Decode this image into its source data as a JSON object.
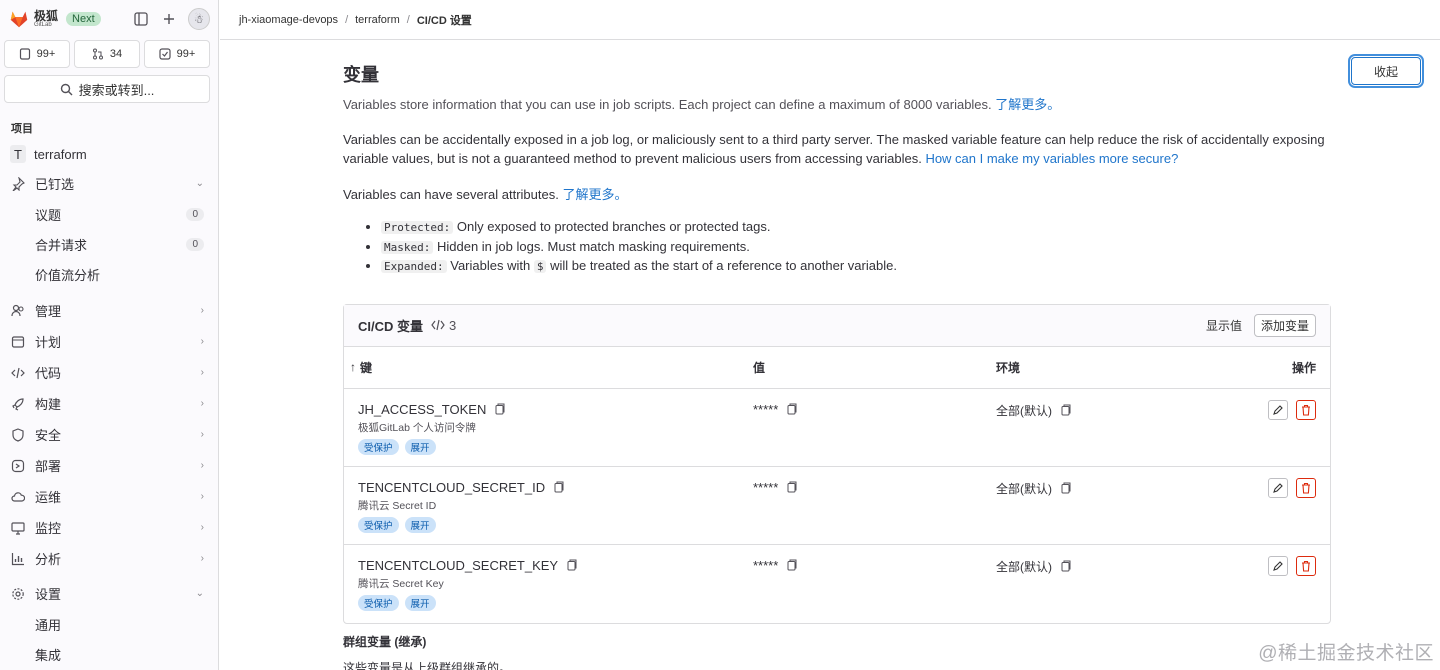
{
  "sidebar": {
    "logo_cn": "极狐",
    "logo_en": "GitLab",
    "next_badge": "Next",
    "counters": [
      {
        "icon": "issues-icon",
        "value": "99+"
      },
      {
        "icon": "merge-request-icon",
        "value": "34"
      },
      {
        "icon": "todo-icon",
        "value": "99+"
      }
    ],
    "search_label": "搜索或转到...",
    "section_label": "项目",
    "project_initial": "T",
    "project_name": "terraform",
    "pinned": {
      "label": "已钉选",
      "items": [
        {
          "label": "议题",
          "count": "0"
        },
        {
          "label": "合并请求",
          "count": "0"
        },
        {
          "label": "价值流分析"
        }
      ]
    },
    "nav": [
      {
        "label": "管理",
        "icon": "users-icon"
      },
      {
        "label": "计划",
        "icon": "plan-icon"
      },
      {
        "label": "代码",
        "icon": "code-icon"
      },
      {
        "label": "构建",
        "icon": "rocket-icon"
      },
      {
        "label": "安全",
        "icon": "shield-icon"
      },
      {
        "label": "部署",
        "icon": "deploy-icon"
      },
      {
        "label": "运维",
        "icon": "cloud-icon"
      },
      {
        "label": "监控",
        "icon": "monitor-icon"
      },
      {
        "label": "分析",
        "icon": "chart-icon"
      }
    ],
    "settings": {
      "label": "设置",
      "items": [
        {
          "label": "通用"
        },
        {
          "label": "集成"
        }
      ]
    }
  },
  "breadcrumb": [
    "jh-xiaomage-devops",
    "terraform",
    "CI/CD 设置"
  ],
  "main": {
    "title": "变量",
    "collapse_button": "收起",
    "desc": "Variables store information that you can use in job scripts. Each project can define a maximum of 8000 variables.",
    "learn_more": "了解更多。",
    "para1": "Variables can be accidentally exposed in a job log, or maliciously sent to a third party server. The masked variable feature can help reduce the risk of accidentally exposing variable values, but is not a guaranteed method to prevent malicious users from accessing variables.",
    "para1_link": "How can I make my variables more secure?",
    "para2": "Variables can have several attributes.",
    "attrs": [
      {
        "code": "Protected:",
        "text": "Only exposed to protected branches or protected tags."
      },
      {
        "code": "Masked:",
        "text": "Hidden in job logs. Must match masking requirements."
      },
      {
        "code": "Expanded:",
        "text_a": "Variables with",
        "code2": "$",
        "text_b": "will be treated as the start of a reference to another variable."
      }
    ],
    "card": {
      "title": "CI/CD 变量",
      "count": "3",
      "reveal_button": "显示值",
      "add_button": "添加变量",
      "columns": {
        "key": "键",
        "value": "值",
        "env": "环境",
        "actions": "操作"
      },
      "rows": [
        {
          "key": "JH_ACCESS_TOKEN",
          "desc": "极狐GitLab 个人访问令牌",
          "badges": [
            "受保护",
            "展开"
          ],
          "value": "*****",
          "env": "全部(默认)"
        },
        {
          "key": "TENCENTCLOUD_SECRET_ID",
          "desc": "腾讯云 Secret ID",
          "badges": [
            "受保护",
            "展开"
          ],
          "value": "*****",
          "env": "全部(默认)"
        },
        {
          "key": "TENCENTCLOUD_SECRET_KEY",
          "desc": "腾讯云 Secret Key",
          "badges": [
            "受保护",
            "展开"
          ],
          "value": "*****",
          "env": "全部(默认)"
        }
      ]
    },
    "group_title": "群组变量 (继承)",
    "group_desc": "这些变量是从上级群组继承的。"
  },
  "watermark": "@稀土掘金技术社区"
}
